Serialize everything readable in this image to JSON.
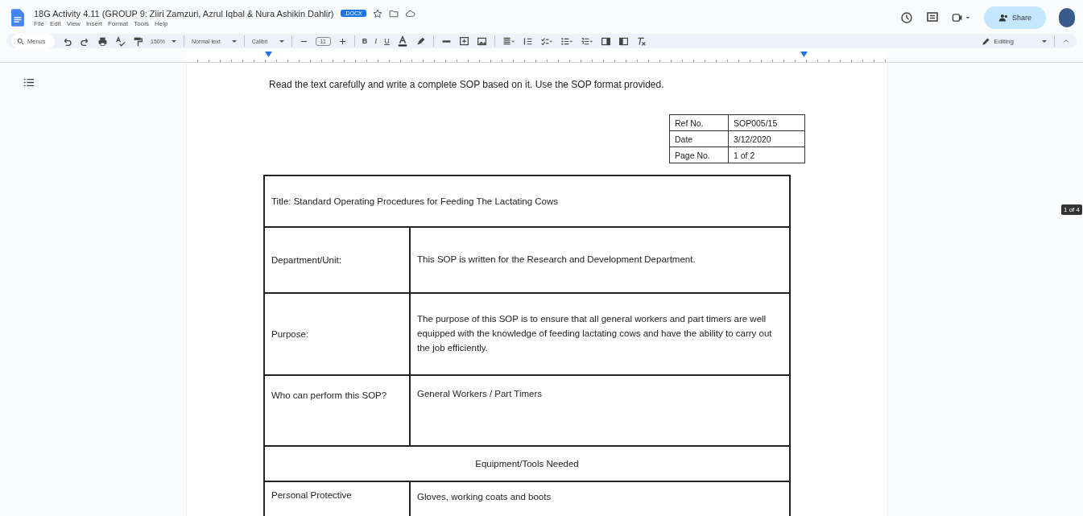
{
  "document_title": "18G Activity 4.11 (GROUP 9: Ziiri Zamzuri, Azrul Iqbal & Nura Ashikin Dahlir)",
  "file_badge": ".DOCX",
  "menus": [
    "File",
    "Edit",
    "View",
    "Insert",
    "Format",
    "Tools",
    "Help"
  ],
  "share_label": "Share",
  "toolbar": {
    "search_placeholder": "Menus",
    "zoom": "150%",
    "style": "Normal text",
    "font": "Calibri",
    "font_size": "11",
    "format_buttons": [
      "B",
      "I",
      "U"
    ],
    "mode": "Editing"
  },
  "page_indicator": "1 of 4",
  "document": {
    "instruction": "Read the text carefully and write a complete SOP based on it. Use the SOP format provided.",
    "ref_table": [
      {
        "label": "Ref No.",
        "value": "SOP005/15"
      },
      {
        "label": "Date",
        "value": "3/12/2020"
      },
      {
        "label": "Page No.",
        "value": "1 of 2"
      }
    ],
    "sop_table": [
      {
        "kind": "title",
        "text": "Title:  Standard Operating Procedures for Feeding The Lactating Cows"
      },
      {
        "kind": "pair",
        "label": "Department/Unit:",
        "text": "This SOP is  written for  the Research and Development Department."
      },
      {
        "kind": "pair",
        "label": "Purpose:",
        "text": "The purpose of this SOP is to ensure that all general workers and part timers are well equipped with the knowledge of feeding lactating cows and have the ability to carry out the job efficiently."
      },
      {
        "kind": "pair",
        "label": "Who can perform this SOP?",
        "text": "General Workers / Part Timers"
      },
      {
        "kind": "heading",
        "text": "Equipment/Tools Needed"
      },
      {
        "kind": "pair",
        "label": "Personal Protective",
        "text": "Gloves, working coats and boots"
      }
    ]
  }
}
